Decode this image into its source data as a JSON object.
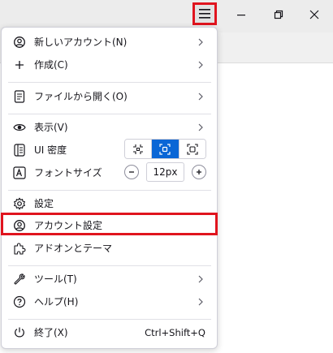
{
  "toolbar": {
    "menu_icon": "hamburger-icon",
    "minimize_icon": "minimize-icon",
    "restore_icon": "restore-icon",
    "close_icon": "close-icon"
  },
  "menu": {
    "new_account": "新しいアカウント(N)",
    "create": "作成(C)",
    "open_file": "ファイルから開く(O)",
    "view": "表示(V)",
    "ui_density": "UI 密度",
    "font_size": "フォントサイズ",
    "zoom_value": "12px",
    "settings": "設定",
    "account_settings": "アカウント設定",
    "addons_themes": "アドオンとテーマ",
    "tools": "ツール(T)",
    "help": "ヘルプ(H)",
    "quit": "終了(X)",
    "quit_shortcut": "Ctrl+Shift+Q"
  },
  "colors": {
    "highlight": "#e0141e",
    "accent": "#0a66d6"
  }
}
